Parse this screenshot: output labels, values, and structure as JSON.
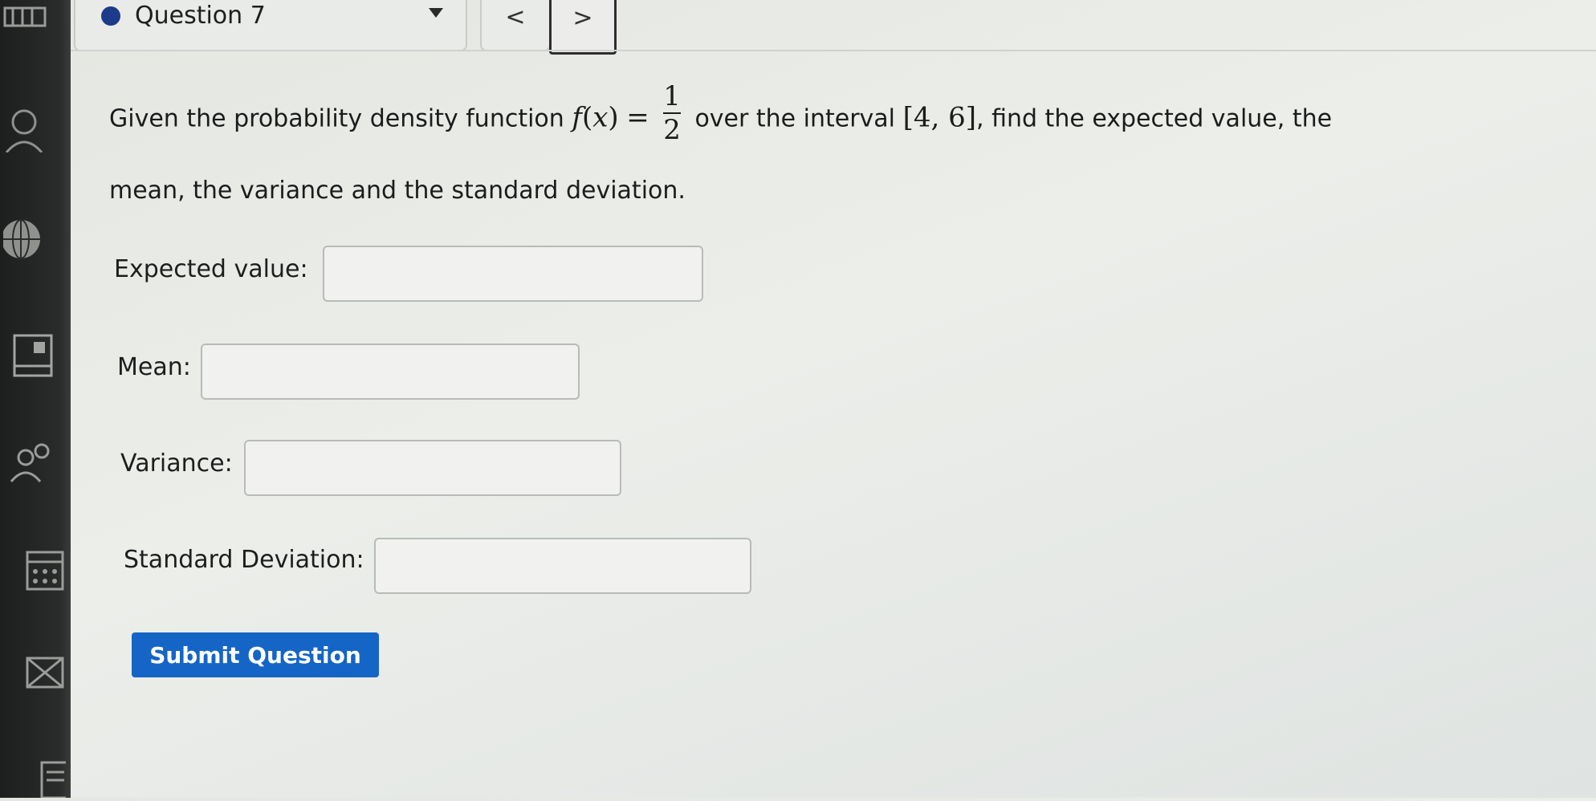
{
  "question_nav": {
    "current": "Question 7",
    "prev_symbol": "<",
    "next_symbol": ">"
  },
  "question": {
    "text_before": "Given the probability density function",
    "function_name": "f",
    "function_var": "x",
    "equals": "=",
    "frac_num": "1",
    "frac_den": "2",
    "text_middle": "over the interval",
    "interval": "[4, 6]",
    "text_after": ", find the expected value, the",
    "line2": "mean, the variance and the standard deviation."
  },
  "fields": {
    "expected_label": "Expected value:",
    "expected_value": "",
    "mean_label": "Mean:",
    "mean_value": "",
    "variance_label": "Variance:",
    "variance_value": "",
    "stddev_label": "Standard Deviation:",
    "stddev_value": ""
  },
  "submit_label": "Submit Question",
  "sidebar_icons": [
    "user-icon",
    "globe-icon",
    "gradebook-icon",
    "people-icon",
    "calendar-icon",
    "mail-icon",
    "notes-icon"
  ],
  "colors": {
    "accent": "#1565c7",
    "status_dot": "#1e3a8a",
    "sidebar": "#242625"
  }
}
